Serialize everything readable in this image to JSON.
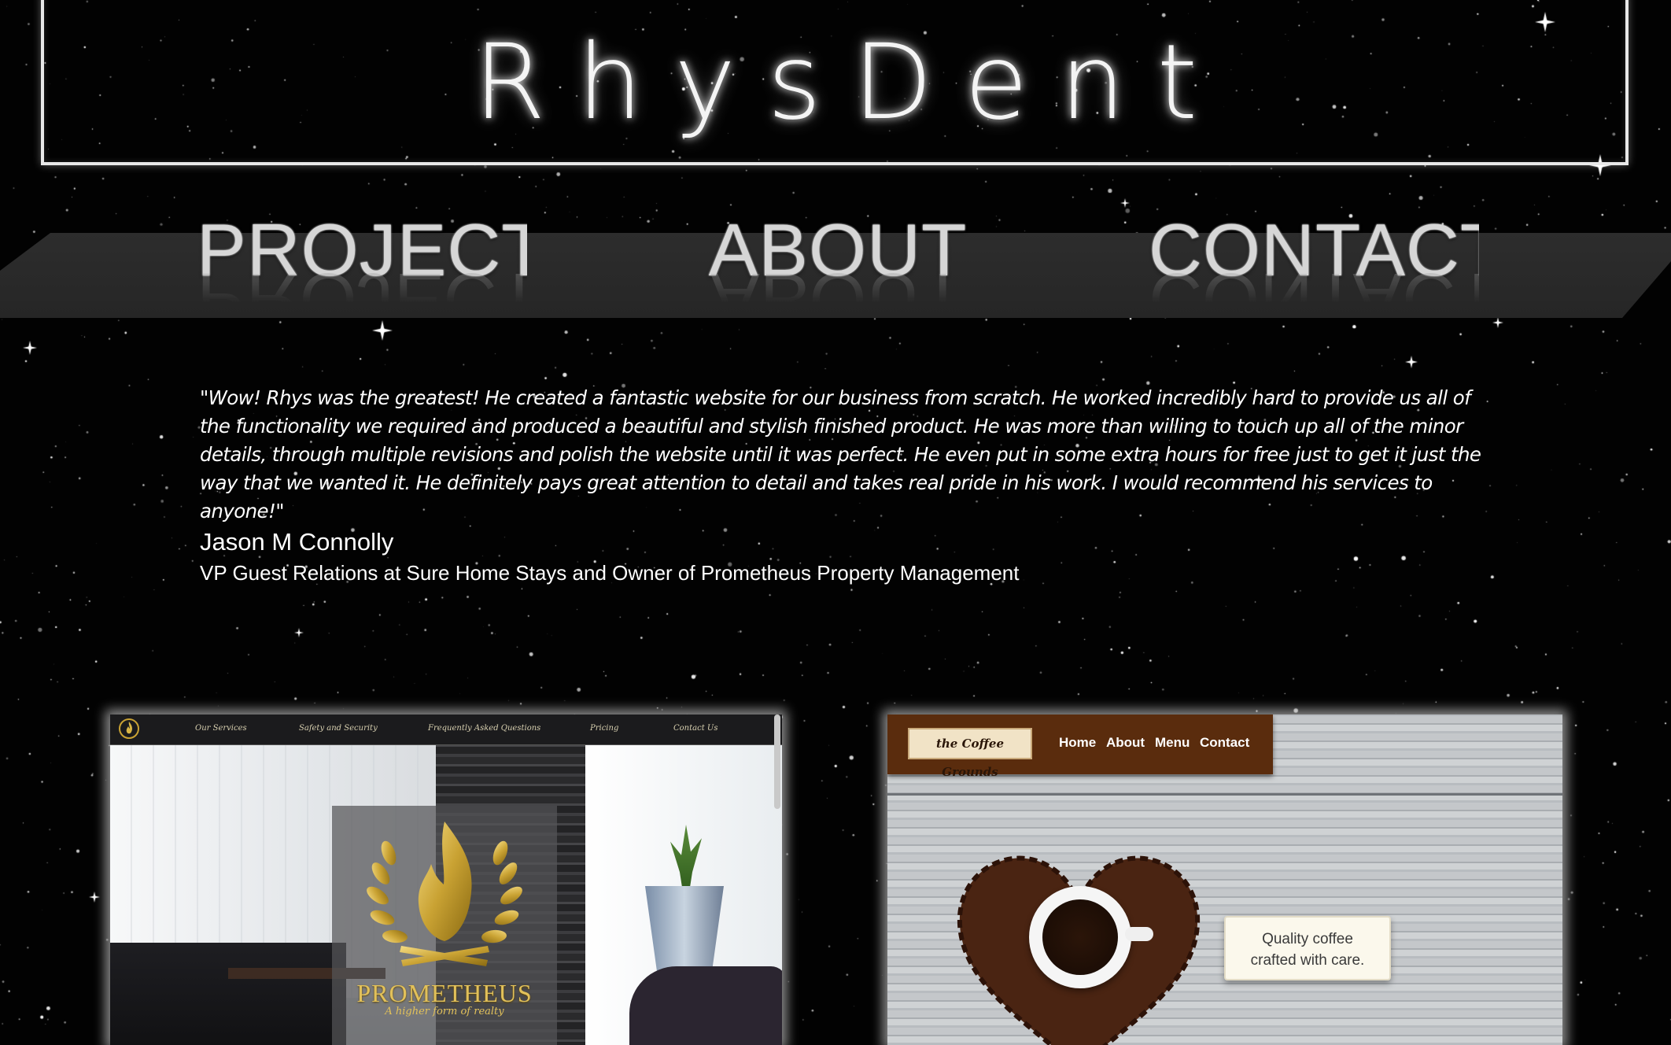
{
  "header": {
    "site_title": "RhysDent"
  },
  "nav": {
    "items": [
      {
        "label": "PROJECTS"
      },
      {
        "label": "ABOUT"
      },
      {
        "label": "CONTACT"
      }
    ]
  },
  "testimonial": {
    "quote": "\"Wow! Rhys was the greatest! He created a fantastic website for our business from scratch. He worked incredibly hard to provide us all of the functionality we required and produced a beautiful and stylish finished product. He was more than willing to touch up all of the minor details, through multiple revisions and polish the website until it was perfect. He even put in some extra hours for free just to get it just the way that we wanted it. He definitely pays great attention to detail and takes real pride in his work. I would recommend his services to anyone!\"",
    "author": "Jason M Connolly",
    "author_title": "VP Guest Relations at Sure Home Stays and Owner of Prometheus Property Management"
  },
  "projects": {
    "prometheus": {
      "nav_items": [
        "Our Services",
        "Safety and Security",
        "Frequently Asked Questions",
        "Pricing",
        "Contact Us"
      ],
      "brand": "PROMETHEUS",
      "tagline": "A higher form of realty"
    },
    "coffee": {
      "logo": "the Coffee Grounds",
      "nav_items": [
        "Home",
        "About",
        "Menu",
        "Contact"
      ],
      "card_line1": "Quality coffee",
      "card_line2": "crafted with care."
    }
  },
  "colors": {
    "background": "#020202",
    "nav_band": "#2b2b2b",
    "gold": "#e2c15a",
    "coffee_brown": "#5a2c0d"
  }
}
